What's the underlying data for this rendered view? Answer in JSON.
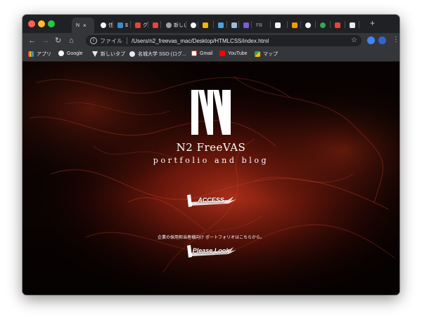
{
  "browser": {
    "tabs": [
      {
        "title": "N",
        "active": true
      },
      {
        "title": "住"
      },
      {
        "title": "$"
      },
      {
        "title": "グ"
      },
      {
        "title": "新しい"
      },
      {
        "title": "‹"
      },
      {
        "title": "‹"
      },
      {
        "title": "‹"
      },
      {
        "title": "‹"
      },
      {
        "title": "FB"
      },
      {
        "title": "‹"
      },
      {
        "title": "‹"
      },
      {
        "title": "‹"
      },
      {
        "title": "‹"
      }
    ],
    "new_tab_symbol": "+",
    "close_symbol": "×",
    "address": {
      "scheme_label": "ファイル",
      "url": "/Users/n2_freevas_mac/Desktop/HTMLCSS/index.html"
    },
    "bookmarks": [
      {
        "label": "アプリ",
        "icon": "apps-grid-icon",
        "color": "#e8453c"
      },
      {
        "label": "Google",
        "icon": "google-icon",
        "color": "#4285f4"
      },
      {
        "label": "新しいタブ",
        "icon": "triangle-icon",
        "color": "#e8eaed"
      },
      {
        "label": "名城大学 SSO (ログ...",
        "icon": "globe-icon",
        "color": "#e8eaed"
      },
      {
        "label": "Gmail",
        "icon": "gmail-icon",
        "color": "#ea4335"
      },
      {
        "label": "YouTube",
        "icon": "youtube-icon",
        "color": "#ff0000"
      },
      {
        "label": "マップ",
        "icon": "maps-icon",
        "color": "#34a853"
      }
    ]
  },
  "site": {
    "name": "N2 FreeVAS",
    "tagline": "portfolio and blog",
    "access_label": "ACCESS",
    "lead": "企業の採用担当者様向け ポートフォリオはこちらから。",
    "please_label": "Please Look"
  },
  "colors": {
    "accent_red": "#c8321a",
    "background": "#0a0302"
  }
}
